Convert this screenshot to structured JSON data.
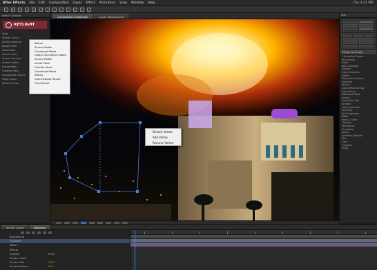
{
  "app": {
    "menu": [
      "After Effects",
      "File",
      "Edit",
      "Composition",
      "Layer",
      "Effect",
      "Animation",
      "View",
      "Window",
      "Help"
    ],
    "status_right": "Thu 3:41 PM"
  },
  "left_panel": {
    "tab_label": "Effect Controls",
    "plugin_name": "KEYLIGHT",
    "fx_items": [
      "View",
      "Screen Colour",
      "Screen Balance",
      "Despill Bias",
      "Alpha Bias",
      "Screen Gain",
      "Screen Pre-blur",
      "Screen Matte",
      "Inside Mask",
      "Outside Mask",
      "Foreground Colour",
      "Edge Colour",
      "Source Crops"
    ]
  },
  "dropdown": {
    "items": [
      "Status",
      "Screen Matte",
      "Combined Matte",
      "Colour Correction Edges",
      "Screen Matte",
      "Inside Mask",
      "Outside Mask",
      "Combined Matte",
      "Status",
      "Intermediate Result",
      "Final Result"
    ]
  },
  "viewer": {
    "tabs": [
      "Composition: Explosion",
      "Layer: Background"
    ],
    "scene": {
      "colors": {
        "fire_core": "#fff6c8",
        "fire_mid": "#ffb400",
        "fire_outer": "#b4320a",
        "sky": "#0a0a16",
        "building": "#b59a70",
        "neon": "#9b4bd8"
      }
    }
  },
  "context_menu": {
    "items": [
      "Stretch Vertex",
      "Add Vertex",
      "Remove Vertex"
    ]
  },
  "right_panel": {
    "header": "Info",
    "section_label": "Effects & Presets",
    "list": [
      "* Animation Presets",
      "3D Channel",
      "Audio",
      "Blur & Sharpen",
      "Channel",
      "Color Correction",
      "Distort",
      "Expression Controls",
      "Generate",
      "Keying",
      "Color Difference Key",
      "Color Range",
      "Difference Matte",
      "Extract",
      "Inner/Outer Key",
      "Keylight",
      "Linear Color Key",
      "Luma Key",
      "Spill Suppressor",
      "Matte",
      "Noise & Grain",
      "Obsolete",
      "Perspective",
      "Simulation",
      "Stylize",
      "Synthetic Aperture",
      "Text",
      "Time",
      "Transition",
      "Utility"
    ]
  },
  "timeline": {
    "tabs": [
      "Render Queue",
      "Explosion"
    ],
    "rows": [
      {
        "name": "Background",
        "value": ""
      },
      {
        "name": "Explosion",
        "value": ""
      },
      {
        "name": "Masks",
        "value": ""
      },
      {
        "name": "Effects",
        "value": ""
      },
      {
        "name": "Keylight",
        "value": "Reset"
      },
      {
        "name": "Screen Colour",
        "value": ""
      },
      {
        "name": "Screen Gain",
        "value": "100.0"
      },
      {
        "name": "Screen Balance",
        "value": "50.0"
      }
    ]
  }
}
